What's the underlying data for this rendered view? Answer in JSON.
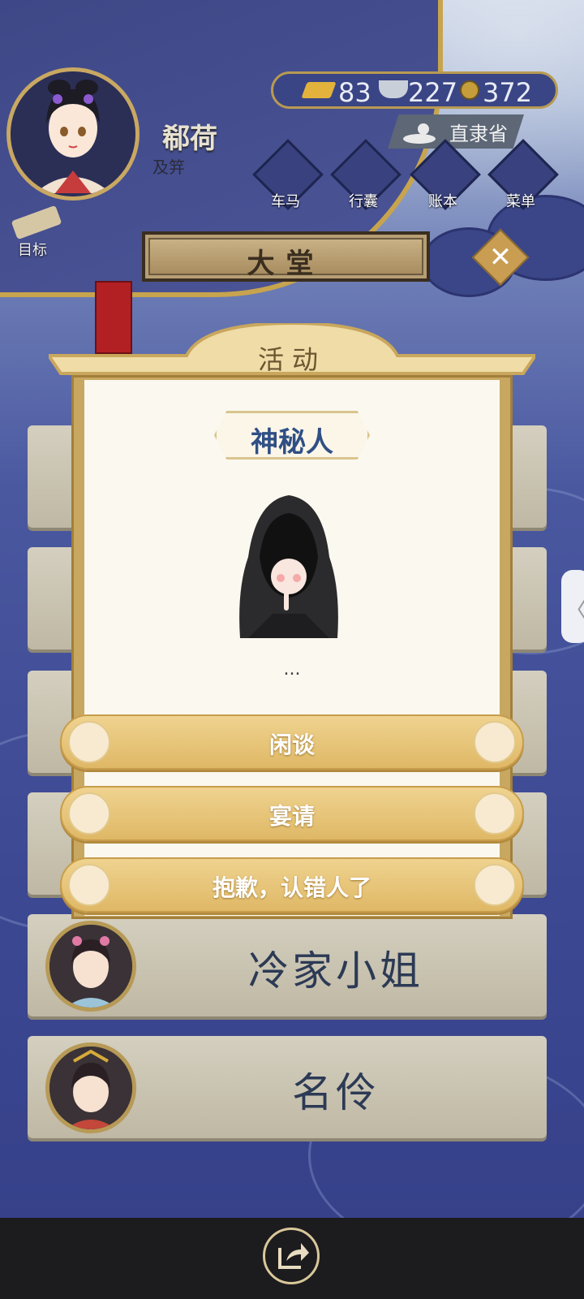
{
  "player": {
    "name": "郗荷",
    "rank": "及笄",
    "location": "直隶省"
  },
  "currency": {
    "gold": "83",
    "silver": "227",
    "coins": "372"
  },
  "menu": {
    "carriage": "车马",
    "luggage": "行囊",
    "ledger": "账本",
    "more": "菜单"
  },
  "goal_label": "目标",
  "hall_title": "大堂",
  "npc_list": [
    {
      "name": "冷家小姐"
    },
    {
      "name": "名伶"
    }
  ],
  "modal": {
    "title": "活动",
    "npc_name": "神秘人",
    "dialogue": "...",
    "options": [
      "闲谈",
      "宴请",
      "抱歉，认错人了"
    ]
  },
  "side_tab_glyph": "〈",
  "close_glyph": "✕",
  "colors": {
    "accent_gold": "#c8a860",
    "name_blue": "#2f4f85",
    "bg_blue": "#3c4892"
  }
}
